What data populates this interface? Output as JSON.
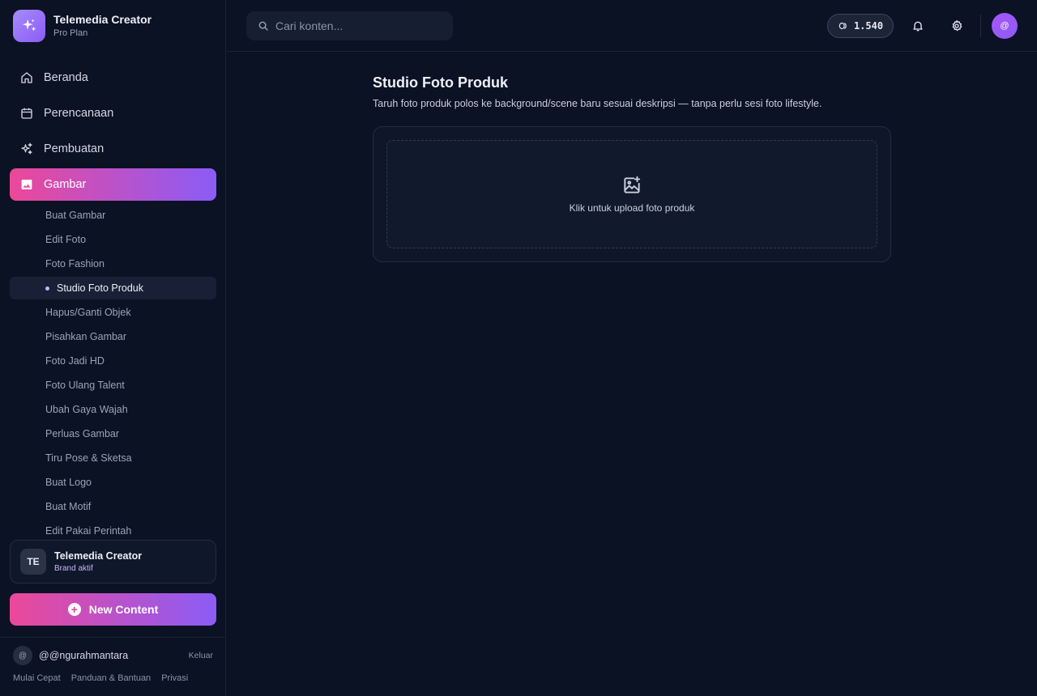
{
  "brand": {
    "title": "Telemedia Creator",
    "plan": "Pro Plan"
  },
  "nav": [
    {
      "label": "Beranda",
      "icon": "home-icon"
    },
    {
      "label": "Perencanaan",
      "icon": "calendar-icon"
    },
    {
      "label": "Pembuatan",
      "icon": "sparkles-icon"
    },
    {
      "label": "Gambar",
      "icon": "image-icon"
    }
  ],
  "subnav": [
    "Buat Gambar",
    "Edit Foto",
    "Foto Fashion",
    "Studio Foto Produk",
    "Hapus/Ganti Objek",
    "Pisahkan Gambar",
    "Foto Jadi HD",
    "Foto Ulang Talent",
    "Ubah Gaya Wajah",
    "Perluas Gambar",
    "Tiru Pose & Sketsa",
    "Buat Logo",
    "Buat Motif",
    "Edit Pakai Perintah"
  ],
  "brand_card": {
    "avatar": "TE",
    "title": "Telemedia Creator",
    "subtitle": "Brand aktif"
  },
  "new_content_label": "New Content",
  "user": {
    "avatar": "@",
    "name": "@@ngurahmantara",
    "logout": "Keluar"
  },
  "footer_links": [
    "Mulai Cepat",
    "Panduan & Bantuan",
    "Privasi"
  ],
  "topbar": {
    "search_placeholder": "Cari konten...",
    "credits": "1.540",
    "avatar": "@"
  },
  "main": {
    "title": "Studio Foto Produk",
    "description": "Taruh foto produk polos ke background/scene baru sesuai deskripsi — tanpa perlu sesi foto lifestyle.",
    "upload_label": "Klik untuk upload foto produk"
  },
  "colors": {
    "accent_start": "#ec4899",
    "accent_end": "#8b5cf6",
    "background": "#0b1224"
  }
}
